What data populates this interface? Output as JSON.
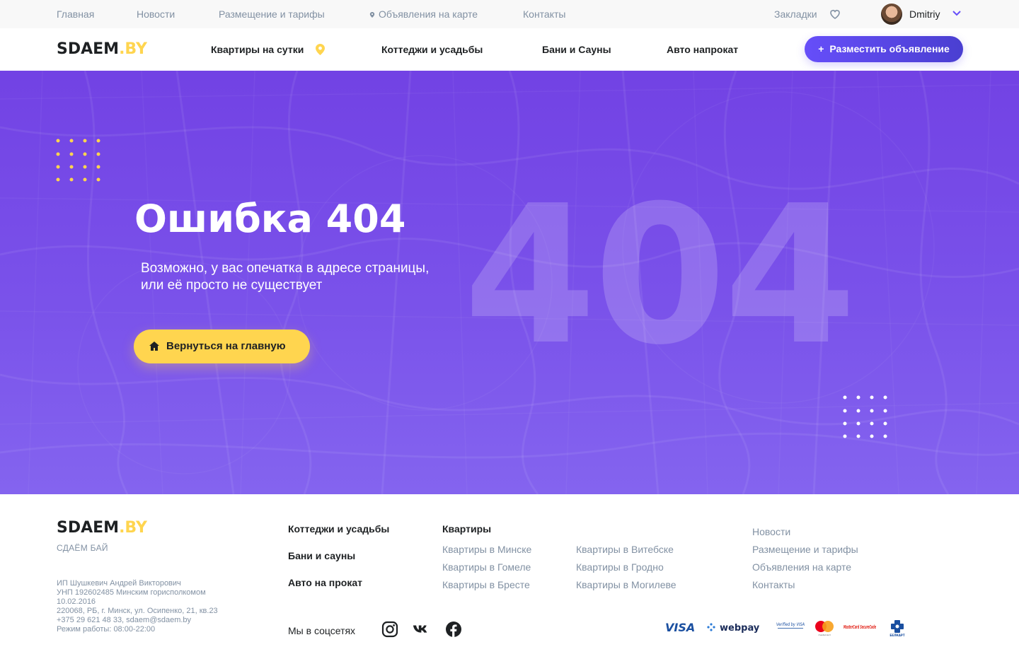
{
  "topbar": {
    "links": [
      "Главная",
      "Новости",
      "Размещение и тарифы",
      "Объявления на карте",
      "Контакты"
    ],
    "bookmarks": "Закладки",
    "username": "Dmitriy"
  },
  "header": {
    "logo_main": "SDAEM",
    "logo_accent": ".BY",
    "nav": [
      "Квартиры на сутки",
      "Коттеджи и усадьбы",
      "Бани и Сауны",
      "Авто напрокат"
    ],
    "post_button": "Разместить объявление",
    "post_plus": "+"
  },
  "hero": {
    "title": "Ошибка 404",
    "subtitle": "Возможно, у вас опечатка в адресе страницы, или её просто не существует",
    "big_number": "404",
    "home_button": "Вернуться на главную"
  },
  "footer": {
    "logo_main": "SDAEM",
    "logo_accent": ".BY",
    "tagline": "СДАЁМ БАЙ",
    "legal": [
      "ИП Шушкевич Андрей Викторович",
      "УНП 192602485 Минским горисполкомом",
      "10.02.2016",
      "220068, РБ, г. Минск, ул. Осипенко, 21, кв.23",
      "+375 29 621 48 33, sdaem@sdaem.by",
      "Режим работы: 08:00-22:00"
    ],
    "categories": [
      "Коттеджи и усадьбы",
      "Бани и сауны",
      "Авто на прокат"
    ],
    "apartments_title": "Квартиры",
    "apartments_col1": [
      "Квартиры в Минске",
      "Квартиры в Гомеле",
      "Квартиры в Бресте"
    ],
    "apartments_col2": [
      "Квартиры в Витебске",
      "Квартиры в Гродно",
      "Квартиры в Могилеве"
    ],
    "links": [
      "Новости",
      "Размещение и тарифы",
      "Объявления на карте",
      "Контакты"
    ],
    "social_label": "Мы в соцсетях",
    "payment_logos": [
      "VISA",
      "webpay",
      "Verified by VISA",
      "mastercard",
      "MasterCard SecureCode",
      "БЕЛКАРТ"
    ]
  },
  "colors": {
    "accent_purple": "#664ef9",
    "accent_yellow": "#ffd54f",
    "text_dark": "#1e2123",
    "text_muted": "#8291a3"
  }
}
